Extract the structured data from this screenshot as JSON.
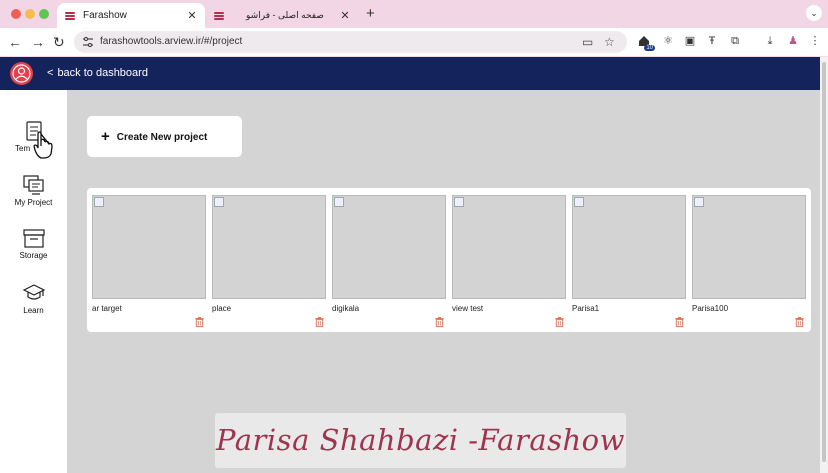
{
  "browser": {
    "tabs": [
      {
        "title": "Farashow",
        "active": true
      },
      {
        "title": "صفحه اصلی - فراشو",
        "active": false
      }
    ],
    "url": "farashowtools.arview.ir/#/project",
    "extension_badge": "10"
  },
  "header": {
    "back_label": "back to dashboard",
    "color": "#14235c"
  },
  "sidebar": {
    "items": [
      {
        "label": "Tem",
        "icon": "template-icon"
      },
      {
        "label": "My Project",
        "icon": "project-icon"
      },
      {
        "label": "Storage",
        "icon": "storage-icon"
      },
      {
        "label": "Learn",
        "icon": "graduation-cap-icon"
      }
    ]
  },
  "main": {
    "create_label": "Create New project",
    "projects": [
      {
        "name": "ar target"
      },
      {
        "name": "place"
      },
      {
        "name": "digikala"
      },
      {
        "name": "view test"
      },
      {
        "name": "Parisa1"
      },
      {
        "name": "Parisa100"
      }
    ]
  },
  "watermark": {
    "text": "Parisa Shahbazi -Farashow"
  },
  "colors": {
    "accent_trash": "#e07a5f",
    "tab_strip": "#f3d6e5"
  }
}
